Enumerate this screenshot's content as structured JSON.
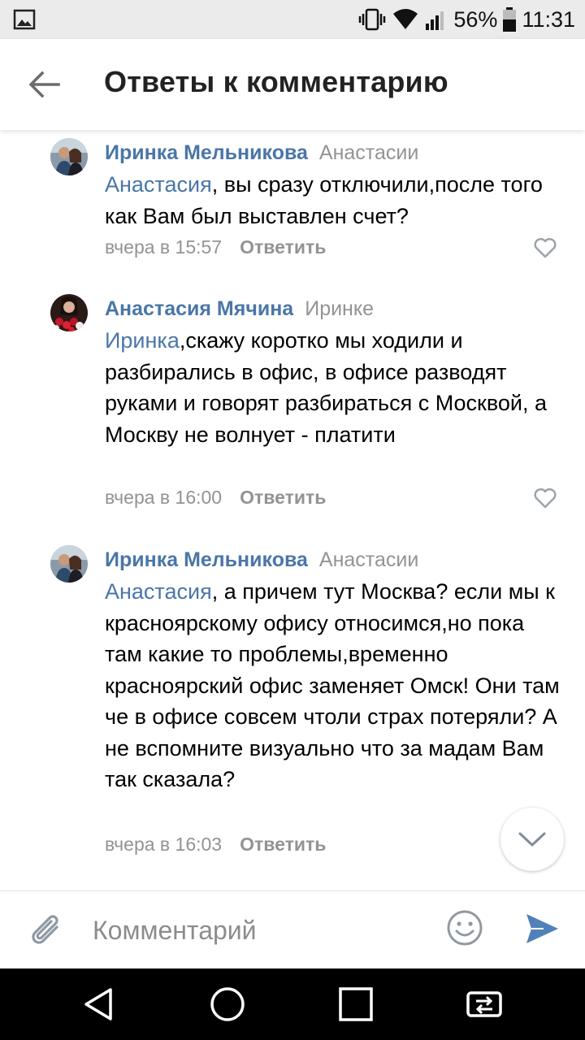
{
  "status_bar": {
    "battery": "56%",
    "time": "11:31"
  },
  "header": {
    "title": "Ответы к комментарию"
  },
  "comments": [
    {
      "author": "Иринка Мельникова",
      "reply_to": "Анастасии",
      "mention": "Анастасия",
      "text": ", вы сразу отключили,после того как Вам был выставлен счет?",
      "time": "вчера в 15:57",
      "reply_label": "Ответить"
    },
    {
      "author": "Анастасия Мячина",
      "reply_to": "Иринке",
      "mention": "Иринка",
      "text": ",скажу коротко мы ходили и разбирались в офис, в офисе разводят руками и говорят разбираться с Москвой, а Москву не волнует - платити",
      "time": "вчера в 16:00",
      "reply_label": "Ответить"
    },
    {
      "author": "Иринка Мельникова",
      "reply_to": "Анастасии",
      "mention": "Анастасия",
      "text": ", а причем тут Москва? если мы к красноярскому офису относимся,но пока там какие то проблемы,временно красноярский офис заменяет Омск! Они там че в офисе совсем чтоли страх потеряли? А не вспомните визуально что за мадам Вам так сказала?",
      "time": "вчера в 16:03",
      "reply_label": "Ответить"
    }
  ],
  "composer": {
    "placeholder": "Комментарий"
  },
  "icons": {
    "back": "arrow-left-icon",
    "like": "heart-outline-icon",
    "scroll_down": "chevron-down-icon",
    "attach": "paperclip-icon",
    "emoji": "smile-icon",
    "send": "send-icon"
  },
  "colors": {
    "link_blue": "#4a76a8",
    "meta_gray": "#939393",
    "send_blue": "#5181b8"
  }
}
